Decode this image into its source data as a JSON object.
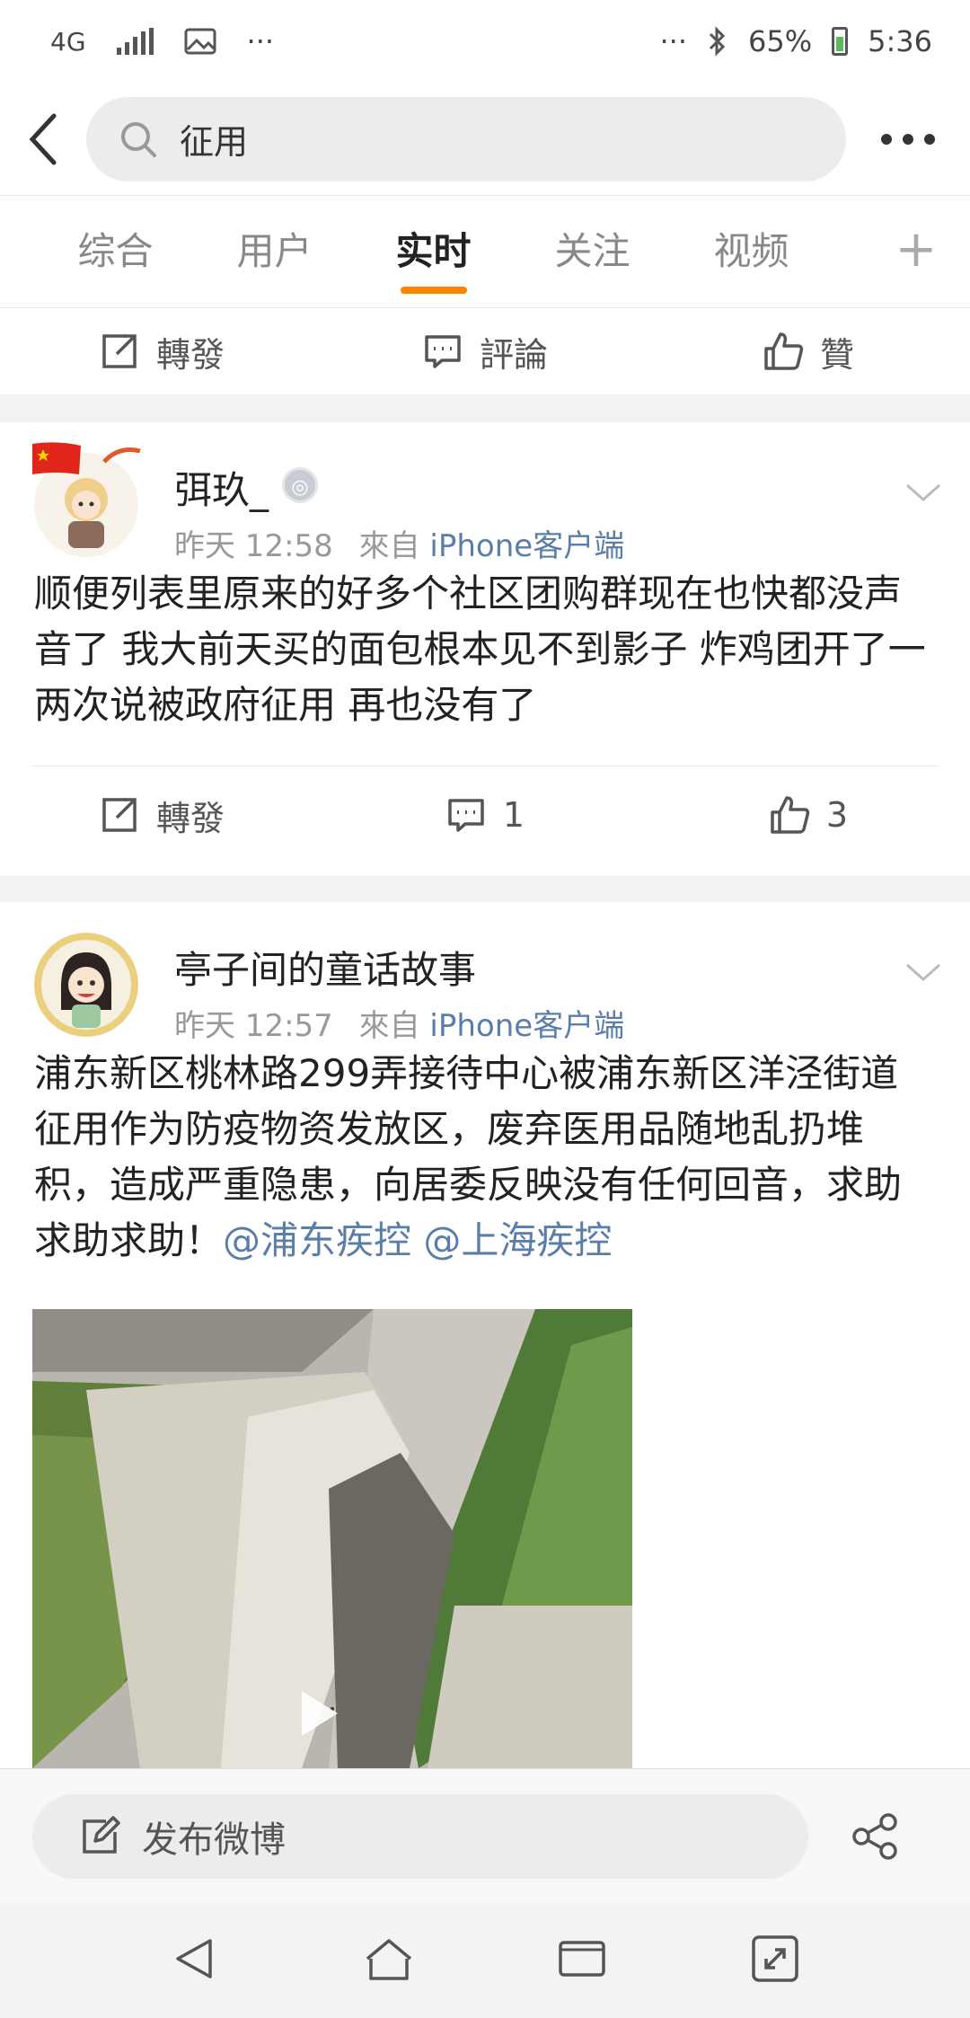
{
  "status_bar": {
    "network": "4G",
    "more_left": "···",
    "more_right": "···",
    "battery": "65%",
    "time": "5:36"
  },
  "search": {
    "query": "征用"
  },
  "tabs": [
    {
      "label": "综合"
    },
    {
      "label": "用户"
    },
    {
      "label": "实时"
    },
    {
      "label": "关注"
    },
    {
      "label": "视频"
    }
  ],
  "tabs_add": "+",
  "top_actions": {
    "repost": "轉發",
    "comment": "評論",
    "like": "贊"
  },
  "posts": [
    {
      "user": "弭玖_",
      "time": "昨天 12:58",
      "from": "來自",
      "source": "iPhone客户端",
      "text": "顺便列表里原来的好多个社区团购群现在也快都没声音了  我大前天买的面包根本见不到影子 炸鸡团开了一两次说被政府征用 再也没有了",
      "repost": "轉發",
      "comments": "1",
      "likes": "3"
    },
    {
      "user": "亭子间的童话故事",
      "time": "昨天 12:57",
      "from": "來自",
      "source": "iPhone客户端",
      "text": "浦东新区桃林路299弄接待中心被浦东新区洋泾街道征用作为防疫物资发放区，废弃医用品随地乱扔堆积，造成严重隐患，向居委反映没有任何回音，求助求助求助！",
      "mention1": "@浦东疾控",
      "mention2": "@上海疾控"
    }
  ],
  "compose": {
    "label": "发布微博"
  }
}
